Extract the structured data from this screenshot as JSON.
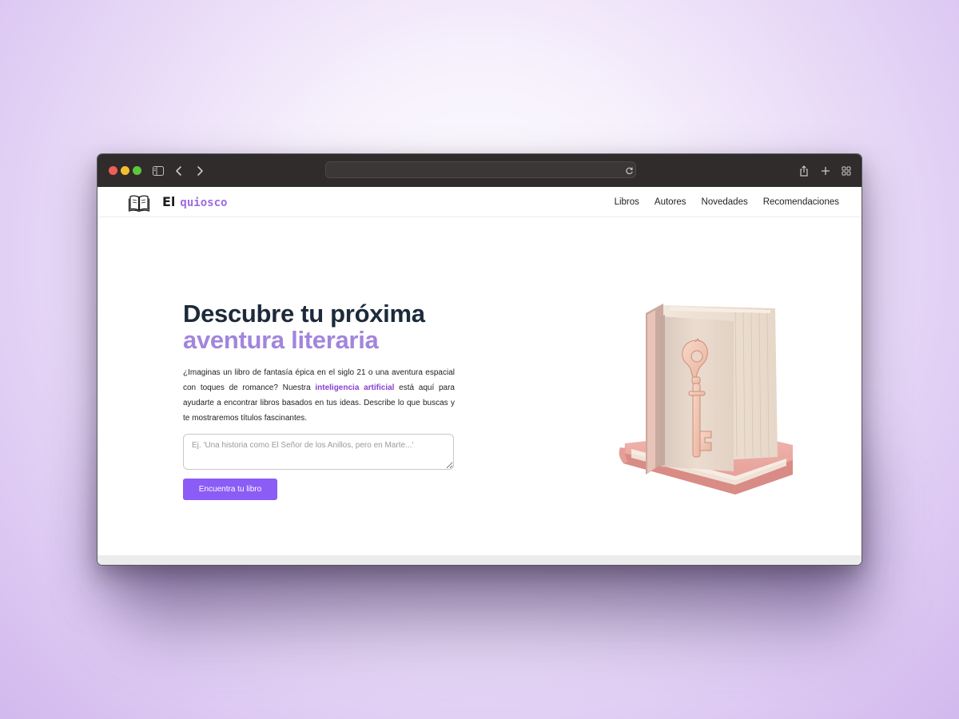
{
  "browser": {
    "address_value": "",
    "icons": [
      "sidebar-icon",
      "back-icon",
      "forward-icon",
      "reload-icon",
      "share-icon",
      "new-tab-icon",
      "tab-overview-icon"
    ]
  },
  "nav": {
    "logo_text": "El",
    "logo_accent": "quiosco",
    "links": [
      "Libros",
      "Autores",
      "Novedades",
      "Recomendaciones"
    ]
  },
  "hero": {
    "title_line1": "Descubre tu próxima",
    "title_line2": "aventura literaria",
    "desc_before": "¿Imaginas un libro de fantasía épica en el siglo 21 o una aventura espacial con toques de romance? Nuestra ",
    "desc_highlight": "inteligencia artificial",
    "desc_after": " está aquí para ayudarte a encontrar libros basados en tus ideas. Describe lo que buscas y te mostraremos títulos fascinantes.",
    "search_placeholder": "Ej. 'Una historia como El Señor de los Anillos, pero en Marte...'",
    "search_value": "",
    "cta_label": "Encuentra tu libro"
  },
  "colors": {
    "accent": "#8b5cf6",
    "title_accent": "#a285dc",
    "highlight": "#8a3fd0",
    "title_dark": "#1c2a3a"
  }
}
